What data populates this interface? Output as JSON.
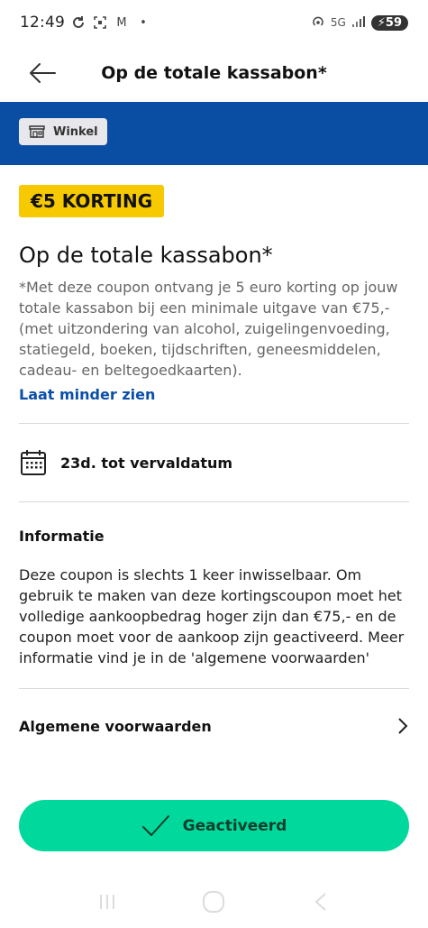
{
  "status_bar": {
    "time": "12:49",
    "network": "5G",
    "battery": "59",
    "notification_icons": [
      "sync-icon",
      "screenshot-icon",
      "gmail-icon",
      "dot-icon"
    ],
    "gmail_glyph": "M",
    "dot_glyph": "•"
  },
  "header": {
    "title": "Op de totale kassabon*",
    "back_icon": "arrow-left-icon"
  },
  "store_chip": {
    "label": "Winkel",
    "icon": "store-icon"
  },
  "coupon": {
    "badge": "€5 KORTING",
    "title": "Op de totale kassabon*",
    "description": "*Met deze coupon ontvang je 5 euro korting op jouw totale kassabon bij een minimale uitgave van €75,- (met uitzondering van alcohol, zuigelingenvoeding, statiegeld, boeken, tijdschriften, geneesmiddelen, cadeau- en beltegoedkaarten).",
    "toggle_label": "Laat minder zien",
    "expiry": "23d. tot vervaldatum",
    "info_heading": "Informatie",
    "info_body": "Deze coupon is slechts 1 keer inwisselbaar. Om gebruik te maken van deze kortingscoupon moet het volledige aankoopbedrag hoger zijn dan €75,- en de coupon moet voor de aankoop zijn geactiveerd. Meer informatie vind je in de 'algemene voorwaarden'",
    "terms_label": "Algemene voorwaarden"
  },
  "action_button": {
    "label": "Geactiveerd",
    "icon": "checkmark-icon"
  },
  "colors": {
    "brand_blue": "#0a4ea3",
    "badge_yellow": "#f7c900",
    "action_green": "#00d99b",
    "link_blue": "#0b4fa8"
  }
}
